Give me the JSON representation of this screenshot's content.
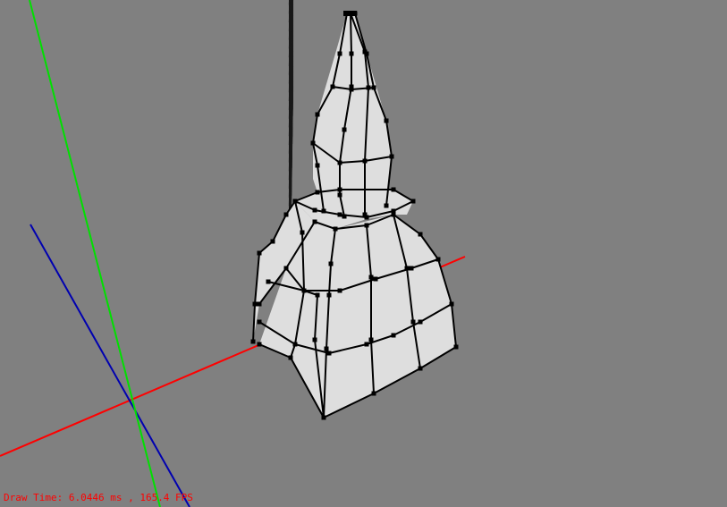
{
  "viewport": {
    "background": "#808080",
    "grid_color": "#1a1a1a",
    "axes": {
      "x": {
        "color": "#ff0000"
      },
      "y": {
        "color": "#00e000"
      },
      "z": {
        "color": "#0000b0"
      }
    },
    "mesh": {
      "fill": "#dedede",
      "edge": "#000000"
    }
  },
  "status": {
    "text": "Draw Time: 6.0446 ms , 165.4 FPS",
    "color": "#ff0000"
  }
}
